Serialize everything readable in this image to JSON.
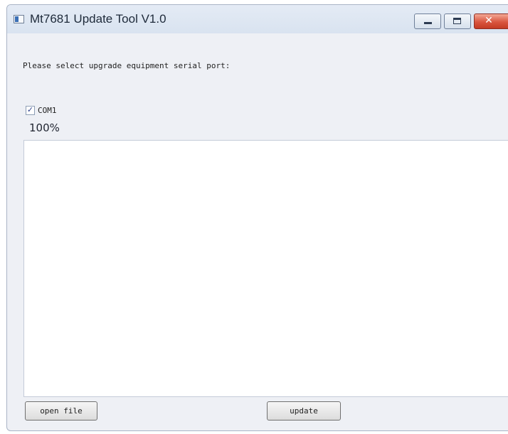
{
  "window": {
    "title": "Mt7681 Update Tool V1.0",
    "icons": {
      "app": "app-window-icon",
      "minimize": "minimize-icon",
      "maximize": "maximize-icon",
      "close": "close-icon"
    },
    "close_glyph": "✕"
  },
  "main": {
    "instruction": "Please select upgrade equipment serial port:",
    "ports": [
      {
        "label": "COM1",
        "checked": true
      }
    ],
    "check_glyph": "✓",
    "progress_text": "100%",
    "progress_value": 100,
    "log_text": ""
  },
  "buttons": {
    "open_file": "open file",
    "update": "update"
  },
  "colors": {
    "titlebar": "#dbe4f0",
    "close_button": "#d9553f",
    "window_body": "#eef0f5"
  }
}
